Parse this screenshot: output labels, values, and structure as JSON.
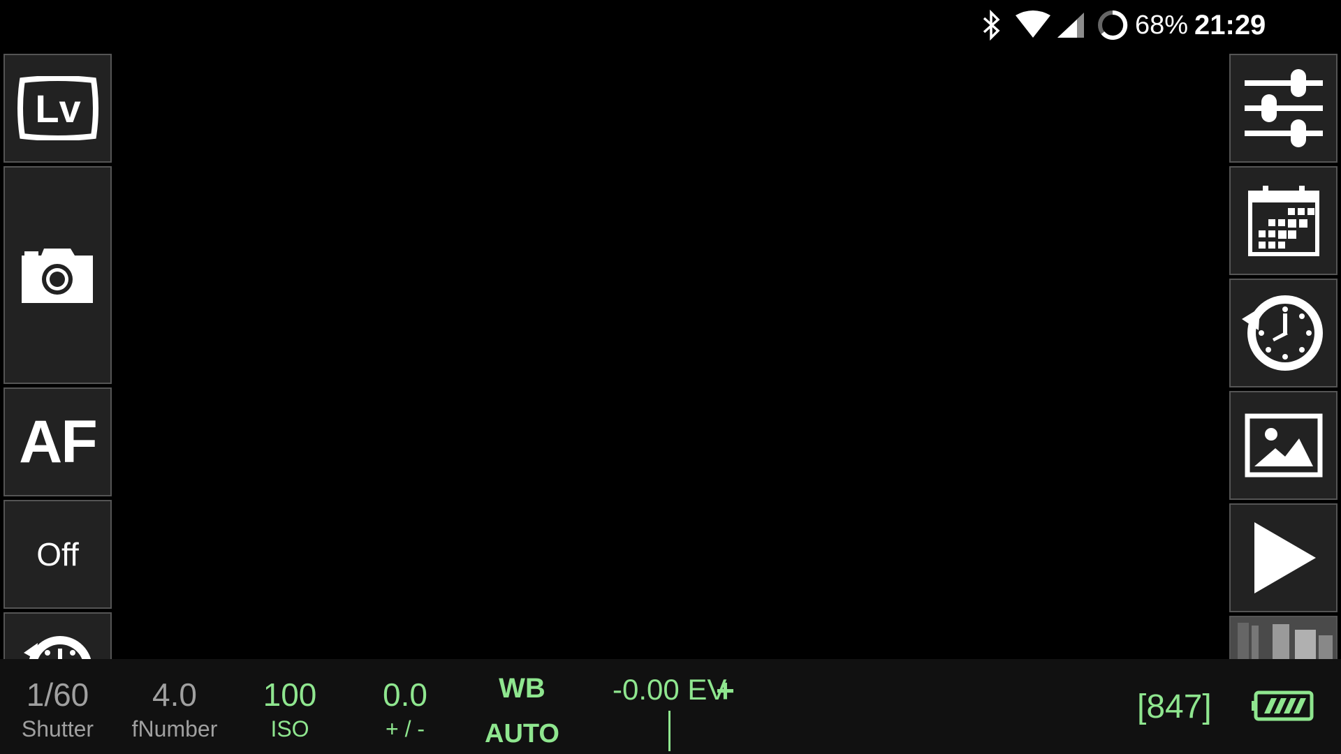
{
  "status_bar": {
    "bluetooth_icon": "bluetooth-icon",
    "wifi_icon": "wifi-icon",
    "signal_icon": "cell-signal-icon",
    "battery_icon": "battery-ring-icon",
    "battery_percent": "68%",
    "time": "21:29"
  },
  "left_panel": {
    "liveview_icon": "lv-icon",
    "shutter_icon": "camera-icon",
    "af_label": "AF",
    "off_label": "Off",
    "timer_icon": "timer-icon"
  },
  "right_panel": {
    "settings_icon": "sliders-icon",
    "schedule_icon": "calendar-icon",
    "history_icon": "clock-history-icon",
    "gallery_icon": "image-icon",
    "play_icon": "play-icon",
    "thumbnail_icon": "photo-thumbnail-icon"
  },
  "exposure": {
    "shutter_value": "1/60",
    "shutter_label": "Shutter",
    "fnumber_value": "4.0",
    "fnumber_label": "fNumber",
    "iso_value": "100",
    "iso_label": "ISO",
    "ev_comp_value": "0.0",
    "ev_comp_label": "+ / -",
    "wb_label": "WB",
    "wb_value": "AUTO",
    "ev_meter": "-0.00 EV",
    "ev_plus": "+",
    "ev_meter_level": 0
  },
  "shots_remaining": "[847]",
  "camera_battery_icon": "camera-battery-icon",
  "colors": {
    "accent_green": "#8fe68f",
    "gray_text": "#a0a0a0",
    "tile_bg": "#222222",
    "tile_border": "#555555"
  }
}
